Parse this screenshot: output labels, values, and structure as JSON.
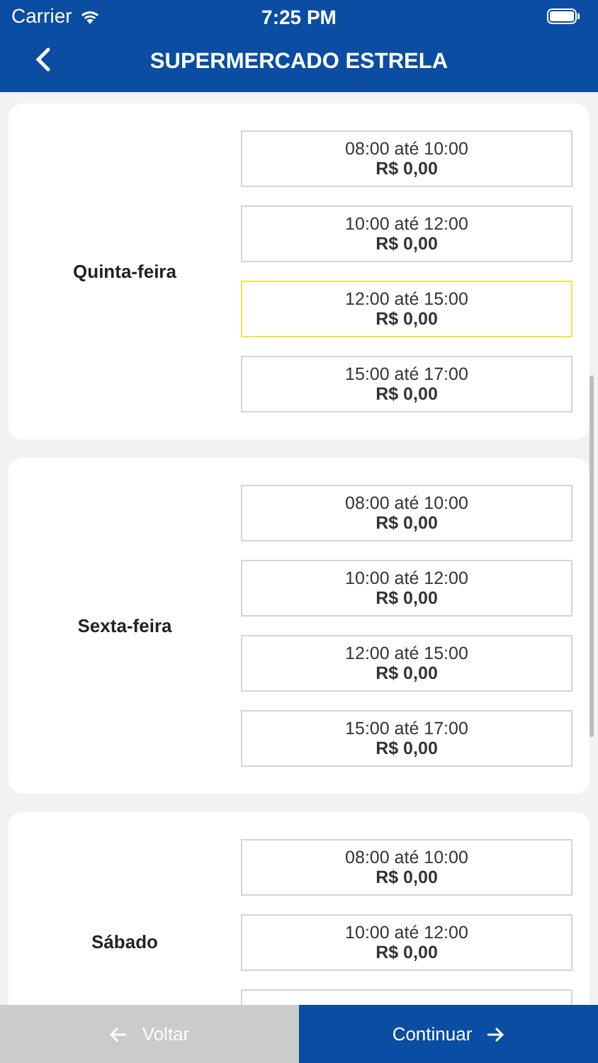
{
  "status_bar": {
    "carrier": "Carrier",
    "time": "7:25 PM"
  },
  "header": {
    "title": "SUPERMERCADO ESTRELA"
  },
  "days": [
    {
      "label": "Quinta-feira",
      "slots": [
        {
          "time": "08:00 até 10:00",
          "price": "R$ 0,00",
          "selected": false
        },
        {
          "time": "10:00 até 12:00",
          "price": "R$ 0,00",
          "selected": false
        },
        {
          "time": "12:00 até 15:00",
          "price": "R$ 0,00",
          "selected": true
        },
        {
          "time": "15:00 até 17:00",
          "price": "R$ 0,00",
          "selected": false
        }
      ]
    },
    {
      "label": "Sexta-feira",
      "slots": [
        {
          "time": "08:00 até 10:00",
          "price": "R$ 0,00",
          "selected": false
        },
        {
          "time": "10:00 até 12:00",
          "price": "R$ 0,00",
          "selected": false
        },
        {
          "time": "12:00 até 15:00",
          "price": "R$ 0,00",
          "selected": false
        },
        {
          "time": "15:00 até 17:00",
          "price": "R$ 0,00",
          "selected": false
        }
      ]
    },
    {
      "label": "Sábado",
      "slots": [
        {
          "time": "08:00 até 10:00",
          "price": "R$ 0,00",
          "selected": false
        },
        {
          "time": "10:00 até 12:00",
          "price": "R$ 0,00",
          "selected": false
        },
        {
          "selected": false
        }
      ]
    }
  ],
  "footer": {
    "back": {
      "label": "Voltar",
      "disabled": true
    },
    "next": {
      "label": "Continuar",
      "disabled": false
    }
  }
}
